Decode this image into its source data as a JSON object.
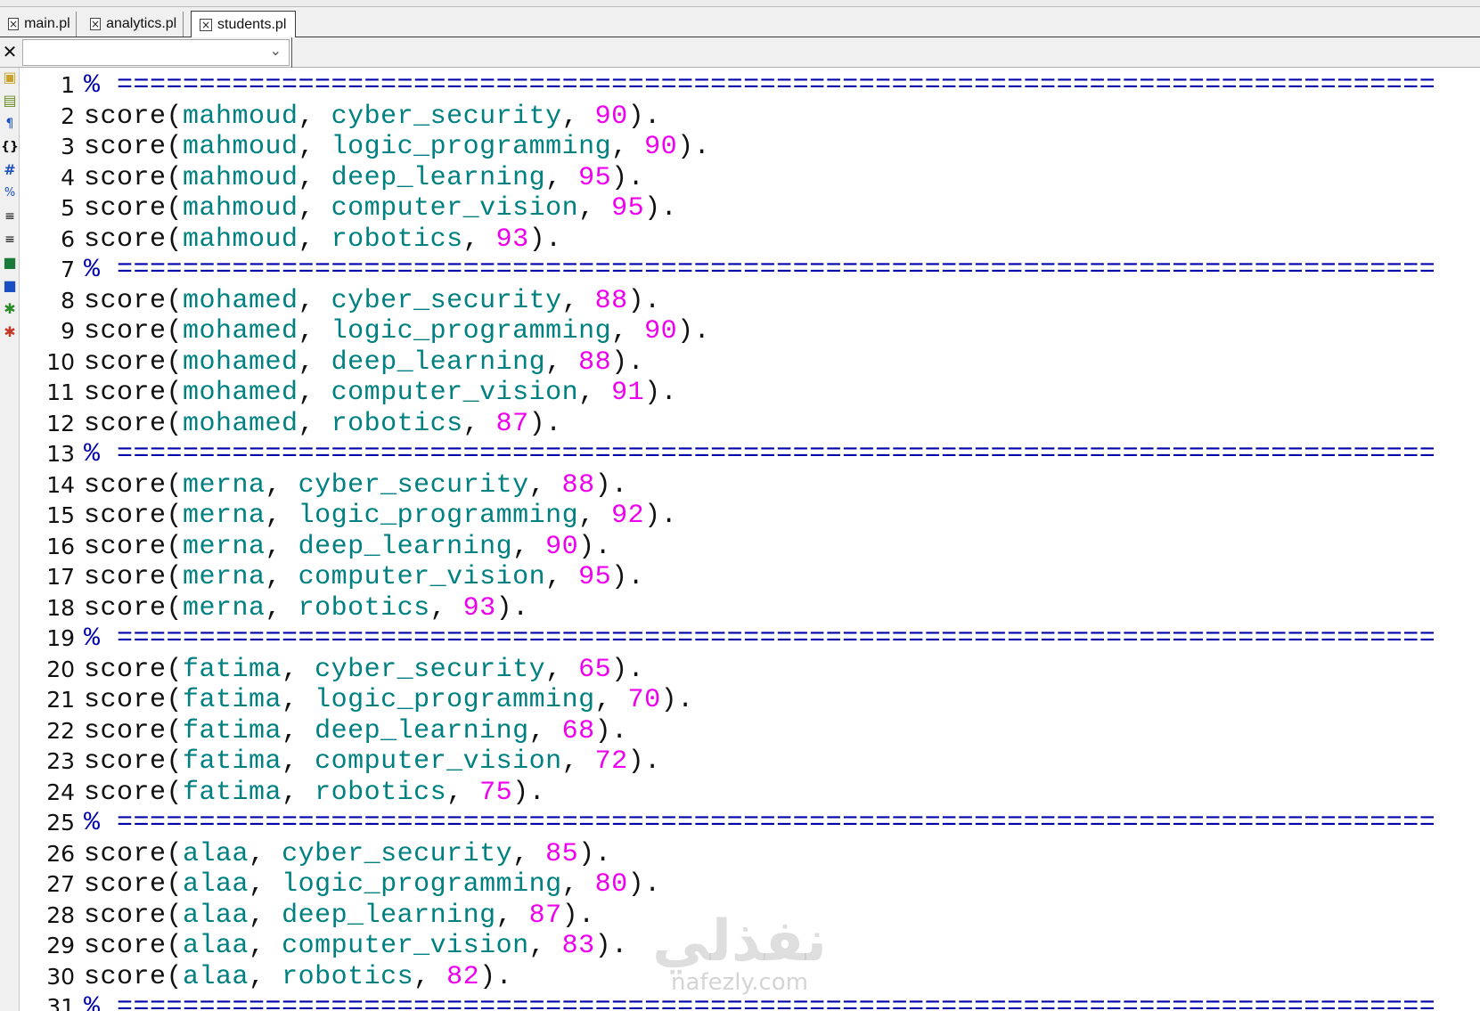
{
  "tabs": [
    {
      "label": "main.pl",
      "active": false
    },
    {
      "label": "analytics.pl",
      "active": false
    },
    {
      "label": "students.pl",
      "active": true
    }
  ],
  "toolbar": {
    "close_glyph": "✕",
    "combo_value": ""
  },
  "toolbar_icons": [
    "open-file-icon",
    "save-file-icon",
    "pilcrow-icon",
    "braces-icon",
    "hash-icon",
    "percent-icon",
    "indent-icon",
    "outdent-icon",
    "bookmark-icon",
    "bookmark-clear-icon",
    "bug-icon",
    "bug-stop-icon"
  ],
  "editor": {
    "language": "prolog",
    "colors": {
      "keyword": "#111111",
      "atom": "#008080",
      "number": "#ee00ee",
      "comment": "#0000aa"
    },
    "lines": [
      {
        "n": "1",
        "type": "comment",
        "text": "% ================================================================================"
      },
      {
        "n": "2",
        "type": "fact",
        "student": "mahmoud",
        "subject": "cyber_security",
        "score": "90"
      },
      {
        "n": "3",
        "type": "fact",
        "student": "mahmoud",
        "subject": "logic_programming",
        "score": "90"
      },
      {
        "n": "4",
        "type": "fact",
        "student": "mahmoud",
        "subject": "deep_learning",
        "score": "95"
      },
      {
        "n": "5",
        "type": "fact",
        "student": "mahmoud",
        "subject": "computer_vision",
        "score": "95"
      },
      {
        "n": "6",
        "type": "fact",
        "student": "mahmoud",
        "subject": "robotics",
        "score": "93"
      },
      {
        "n": "7",
        "type": "comment",
        "text": "% ================================================================================"
      },
      {
        "n": "8",
        "type": "fact",
        "student": "mohamed",
        "subject": "cyber_security",
        "score": "88"
      },
      {
        "n": "9",
        "type": "fact",
        "student": "mohamed",
        "subject": "logic_programming",
        "score": "90"
      },
      {
        "n": "10",
        "type": "fact",
        "student": "mohamed",
        "subject": "deep_learning",
        "score": "88"
      },
      {
        "n": "11",
        "type": "fact",
        "student": "mohamed",
        "subject": "computer_vision",
        "score": "91"
      },
      {
        "n": "12",
        "type": "fact",
        "student": "mohamed",
        "subject": "robotics",
        "score": "87"
      },
      {
        "n": "13",
        "type": "comment",
        "text": "% ================================================================================"
      },
      {
        "n": "14",
        "type": "fact",
        "student": "merna",
        "subject": "cyber_security",
        "score": "88"
      },
      {
        "n": "15",
        "type": "fact",
        "student": "merna",
        "subject": "logic_programming",
        "score": "92"
      },
      {
        "n": "16",
        "type": "fact",
        "student": "merna",
        "subject": "deep_learning",
        "score": "90"
      },
      {
        "n": "17",
        "type": "fact",
        "student": "merna",
        "subject": "computer_vision",
        "score": "95"
      },
      {
        "n": "18",
        "type": "fact",
        "student": "merna",
        "subject": "robotics",
        "score": "93"
      },
      {
        "n": "19",
        "type": "comment",
        "text": "% ================================================================================"
      },
      {
        "n": "20",
        "type": "fact",
        "student": "fatima",
        "subject": "cyber_security",
        "score": "65"
      },
      {
        "n": "21",
        "type": "fact",
        "student": "fatima",
        "subject": "logic_programming",
        "score": "70"
      },
      {
        "n": "22",
        "type": "fact",
        "student": "fatima",
        "subject": "deep_learning",
        "score": "68"
      },
      {
        "n": "23",
        "type": "fact",
        "student": "fatima",
        "subject": "computer_vision",
        "score": "72"
      },
      {
        "n": "24",
        "type": "fact",
        "student": "fatima",
        "subject": "robotics",
        "score": "75"
      },
      {
        "n": "25",
        "type": "comment",
        "text": "% ================================================================================"
      },
      {
        "n": "26",
        "type": "fact",
        "student": "alaa",
        "subject": "cyber_security",
        "score": "85"
      },
      {
        "n": "27",
        "type": "fact",
        "student": "alaa",
        "subject": "logic_programming",
        "score": "80"
      },
      {
        "n": "28",
        "type": "fact",
        "student": "alaa",
        "subject": "deep_learning",
        "score": "87"
      },
      {
        "n": "29",
        "type": "fact",
        "student": "alaa",
        "subject": "computer_vision",
        "score": "83"
      },
      {
        "n": "30",
        "type": "fact",
        "student": "alaa",
        "subject": "robotics",
        "score": "82"
      },
      {
        "n": "31",
        "type": "comment",
        "text": "% ================================================================================"
      }
    ]
  },
  "watermark": {
    "logo": "نفذلي",
    "url": "nafezly.com"
  }
}
